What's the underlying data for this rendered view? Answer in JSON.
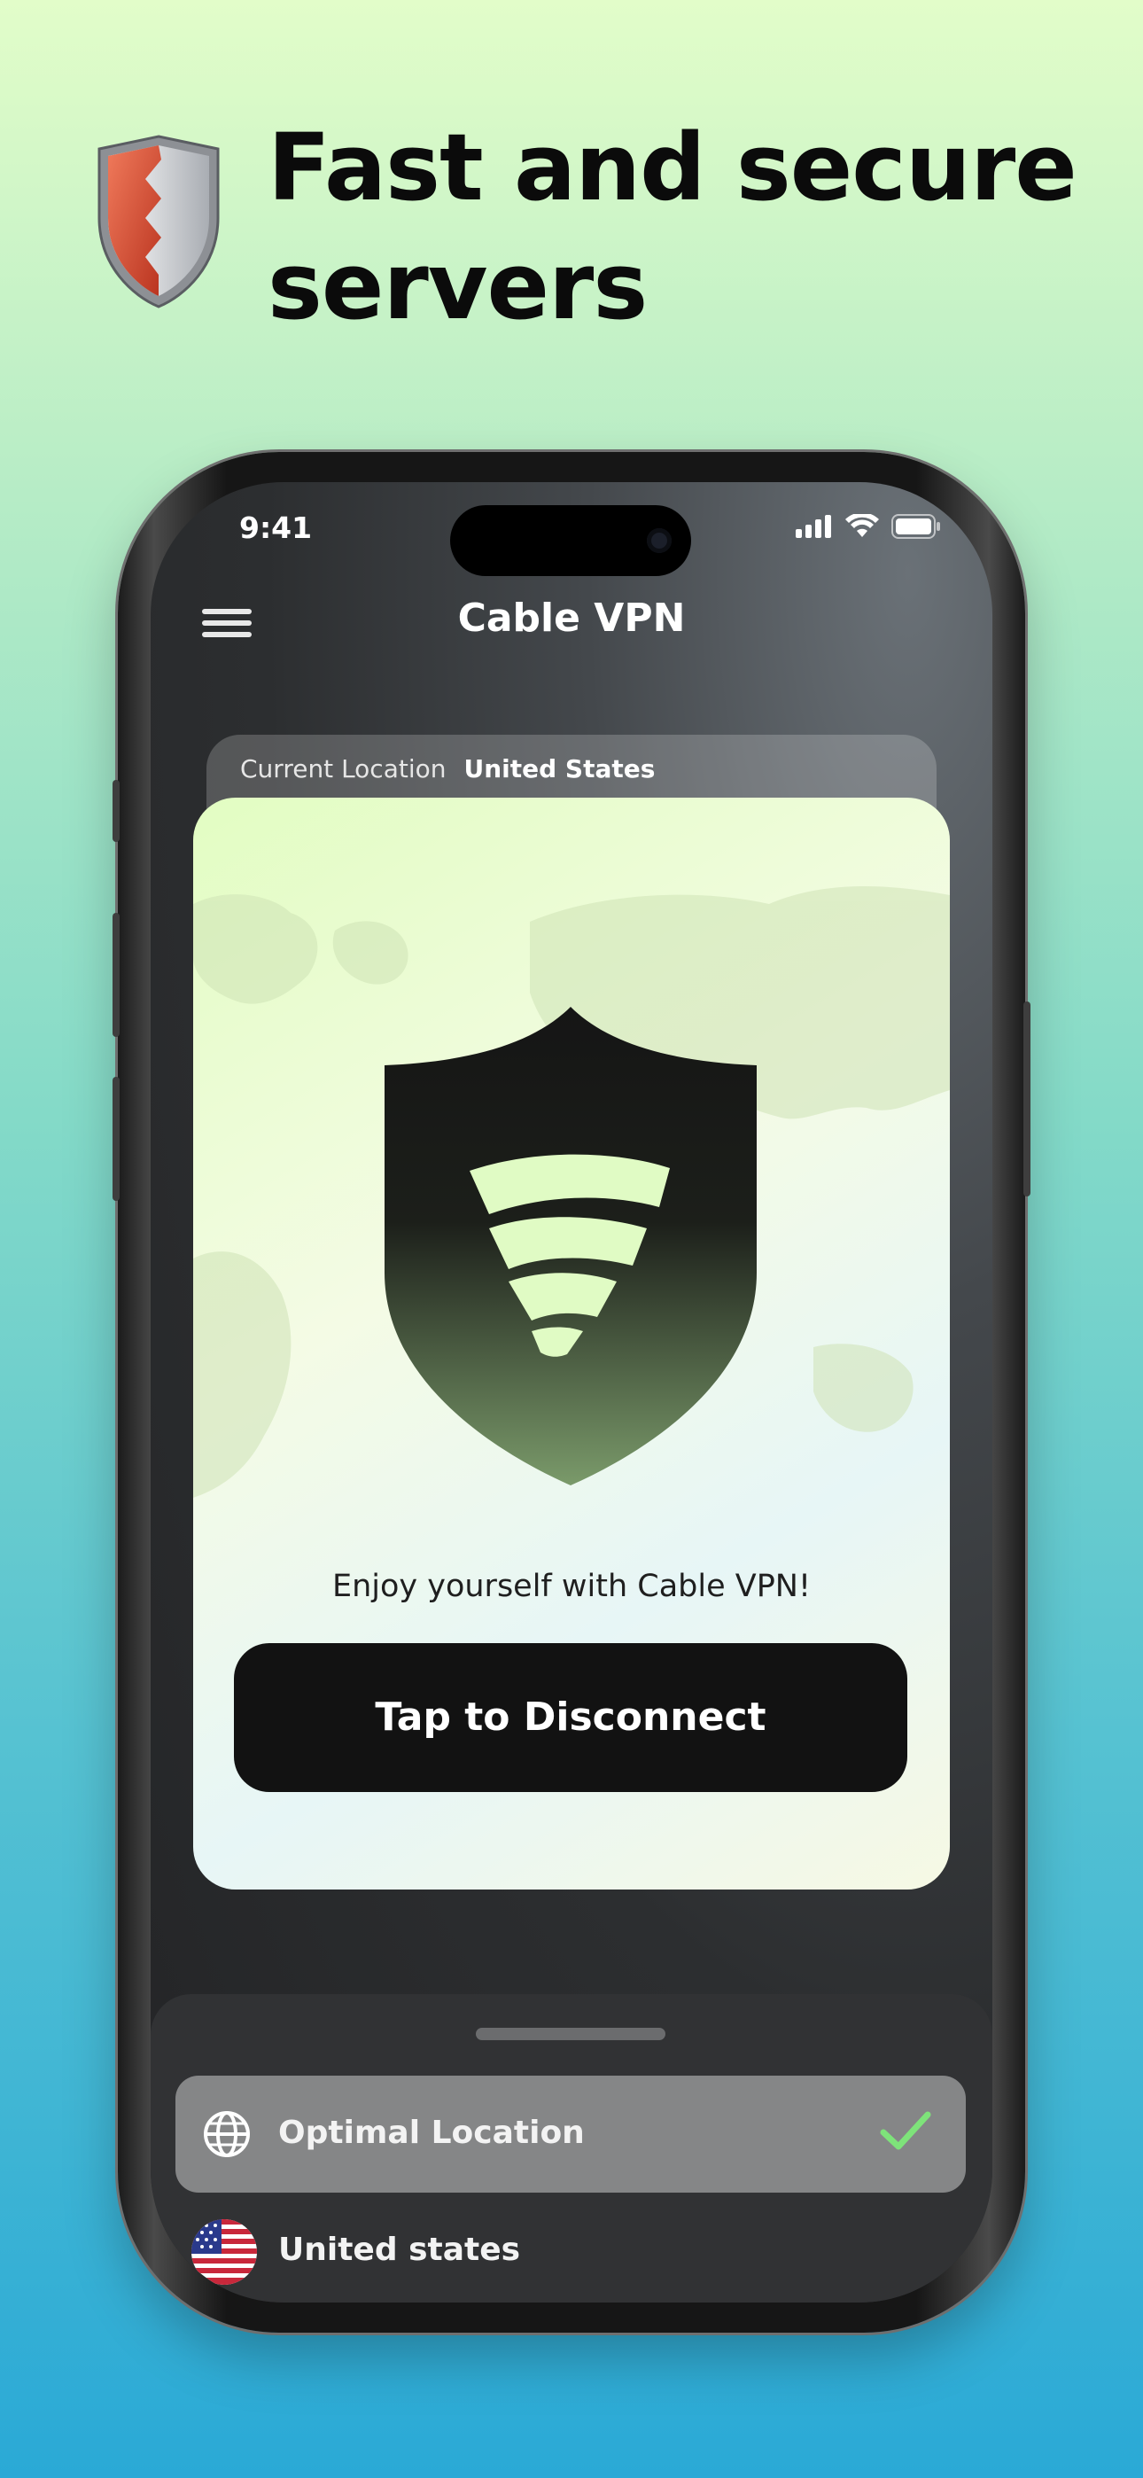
{
  "headline": {
    "line1": "Fast and secure",
    "line2": "servers"
  },
  "status_bar": {
    "time": "9:41"
  },
  "app": {
    "title": "Cable VPN"
  },
  "location": {
    "label": "Current Location",
    "value": "United States"
  },
  "card": {
    "message": "Enjoy yourself with Cable VPN!",
    "button_label": "Tap to Disconnect"
  },
  "server_list": {
    "items": [
      {
        "label": "Optimal Location",
        "icon": "globe-icon",
        "selected": true
      },
      {
        "label": "United states",
        "icon": "us-flag-icon",
        "selected": false
      }
    ]
  },
  "colors": {
    "accent_green": "#7ee37a",
    "shield_light": "#e0fbc4",
    "button_dark": "#121212"
  }
}
